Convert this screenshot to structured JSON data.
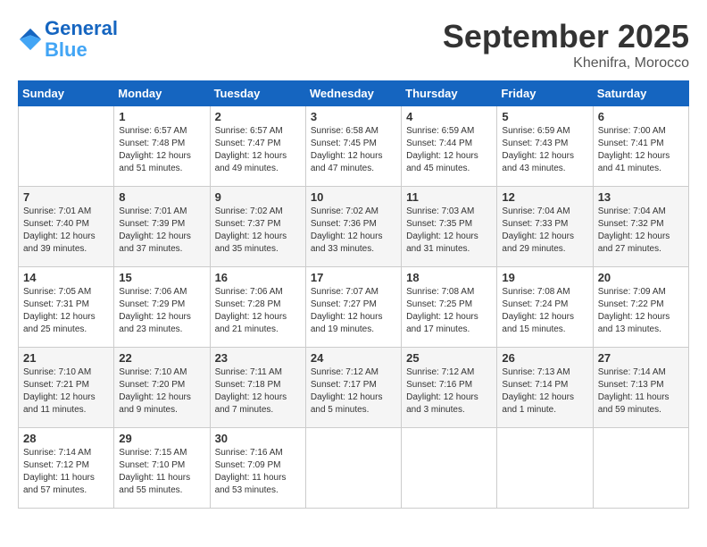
{
  "header": {
    "logo_line1": "General",
    "logo_line2": "Blue",
    "month_title": "September 2025",
    "location": "Khenifra, Morocco"
  },
  "weekdays": [
    "Sunday",
    "Monday",
    "Tuesday",
    "Wednesday",
    "Thursday",
    "Friday",
    "Saturday"
  ],
  "weeks": [
    [
      {
        "day": "",
        "info": ""
      },
      {
        "day": "1",
        "info": "Sunrise: 6:57 AM\nSunset: 7:48 PM\nDaylight: 12 hours\nand 51 minutes."
      },
      {
        "day": "2",
        "info": "Sunrise: 6:57 AM\nSunset: 7:47 PM\nDaylight: 12 hours\nand 49 minutes."
      },
      {
        "day": "3",
        "info": "Sunrise: 6:58 AM\nSunset: 7:45 PM\nDaylight: 12 hours\nand 47 minutes."
      },
      {
        "day": "4",
        "info": "Sunrise: 6:59 AM\nSunset: 7:44 PM\nDaylight: 12 hours\nand 45 minutes."
      },
      {
        "day": "5",
        "info": "Sunrise: 6:59 AM\nSunset: 7:43 PM\nDaylight: 12 hours\nand 43 minutes."
      },
      {
        "day": "6",
        "info": "Sunrise: 7:00 AM\nSunset: 7:41 PM\nDaylight: 12 hours\nand 41 minutes."
      }
    ],
    [
      {
        "day": "7",
        "info": "Sunrise: 7:01 AM\nSunset: 7:40 PM\nDaylight: 12 hours\nand 39 minutes."
      },
      {
        "day": "8",
        "info": "Sunrise: 7:01 AM\nSunset: 7:39 PM\nDaylight: 12 hours\nand 37 minutes."
      },
      {
        "day": "9",
        "info": "Sunrise: 7:02 AM\nSunset: 7:37 PM\nDaylight: 12 hours\nand 35 minutes."
      },
      {
        "day": "10",
        "info": "Sunrise: 7:02 AM\nSunset: 7:36 PM\nDaylight: 12 hours\nand 33 minutes."
      },
      {
        "day": "11",
        "info": "Sunrise: 7:03 AM\nSunset: 7:35 PM\nDaylight: 12 hours\nand 31 minutes."
      },
      {
        "day": "12",
        "info": "Sunrise: 7:04 AM\nSunset: 7:33 PM\nDaylight: 12 hours\nand 29 minutes."
      },
      {
        "day": "13",
        "info": "Sunrise: 7:04 AM\nSunset: 7:32 PM\nDaylight: 12 hours\nand 27 minutes."
      }
    ],
    [
      {
        "day": "14",
        "info": "Sunrise: 7:05 AM\nSunset: 7:31 PM\nDaylight: 12 hours\nand 25 minutes."
      },
      {
        "day": "15",
        "info": "Sunrise: 7:06 AM\nSunset: 7:29 PM\nDaylight: 12 hours\nand 23 minutes."
      },
      {
        "day": "16",
        "info": "Sunrise: 7:06 AM\nSunset: 7:28 PM\nDaylight: 12 hours\nand 21 minutes."
      },
      {
        "day": "17",
        "info": "Sunrise: 7:07 AM\nSunset: 7:27 PM\nDaylight: 12 hours\nand 19 minutes."
      },
      {
        "day": "18",
        "info": "Sunrise: 7:08 AM\nSunset: 7:25 PM\nDaylight: 12 hours\nand 17 minutes."
      },
      {
        "day": "19",
        "info": "Sunrise: 7:08 AM\nSunset: 7:24 PM\nDaylight: 12 hours\nand 15 minutes."
      },
      {
        "day": "20",
        "info": "Sunrise: 7:09 AM\nSunset: 7:22 PM\nDaylight: 12 hours\nand 13 minutes."
      }
    ],
    [
      {
        "day": "21",
        "info": "Sunrise: 7:10 AM\nSunset: 7:21 PM\nDaylight: 12 hours\nand 11 minutes."
      },
      {
        "day": "22",
        "info": "Sunrise: 7:10 AM\nSunset: 7:20 PM\nDaylight: 12 hours\nand 9 minutes."
      },
      {
        "day": "23",
        "info": "Sunrise: 7:11 AM\nSunset: 7:18 PM\nDaylight: 12 hours\nand 7 minutes."
      },
      {
        "day": "24",
        "info": "Sunrise: 7:12 AM\nSunset: 7:17 PM\nDaylight: 12 hours\nand 5 minutes."
      },
      {
        "day": "25",
        "info": "Sunrise: 7:12 AM\nSunset: 7:16 PM\nDaylight: 12 hours\nand 3 minutes."
      },
      {
        "day": "26",
        "info": "Sunrise: 7:13 AM\nSunset: 7:14 PM\nDaylight: 12 hours\nand 1 minute."
      },
      {
        "day": "27",
        "info": "Sunrise: 7:14 AM\nSunset: 7:13 PM\nDaylight: 11 hours\nand 59 minutes."
      }
    ],
    [
      {
        "day": "28",
        "info": "Sunrise: 7:14 AM\nSunset: 7:12 PM\nDaylight: 11 hours\nand 57 minutes."
      },
      {
        "day": "29",
        "info": "Sunrise: 7:15 AM\nSunset: 7:10 PM\nDaylight: 11 hours\nand 55 minutes."
      },
      {
        "day": "30",
        "info": "Sunrise: 7:16 AM\nSunset: 7:09 PM\nDaylight: 11 hours\nand 53 minutes."
      },
      {
        "day": "",
        "info": ""
      },
      {
        "day": "",
        "info": ""
      },
      {
        "day": "",
        "info": ""
      },
      {
        "day": "",
        "info": ""
      }
    ]
  ]
}
